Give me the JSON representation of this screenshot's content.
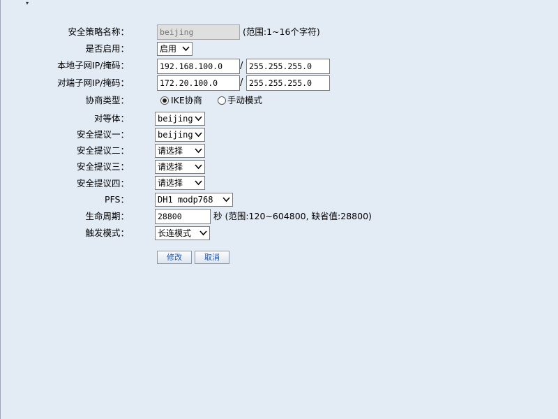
{
  "form": {
    "policy_name": {
      "label": "安全策略名称：",
      "value": "beijing",
      "hint": "(范围:1~16个字符)"
    },
    "enable": {
      "label": "是否启用：",
      "selected": "启用"
    },
    "local_subnet": {
      "label": "本地子网IP/掩码：",
      "ip": "192.168.100.0",
      "separator": "/",
      "mask": "255.255.255.0"
    },
    "remote_subnet": {
      "label": "对端子网IP/掩码：",
      "ip": "172.20.100.0",
      "separator": "/",
      "mask": "255.255.255.0"
    },
    "negotiation": {
      "label": "协商类型：",
      "option_ike": "IKE协商",
      "option_manual": "手动模式",
      "selected": "IKE协商"
    },
    "peer": {
      "label": "对等体：",
      "selected": "beijing"
    },
    "proposal1": {
      "label": "安全提议一：",
      "selected": "beijing"
    },
    "proposal2": {
      "label": "安全提议二：",
      "selected": "请选择"
    },
    "proposal3": {
      "label": "安全提议三：",
      "selected": "请选择"
    },
    "proposal4": {
      "label": "安全提议四：",
      "selected": "请选择"
    },
    "pfs": {
      "label": "PFS：",
      "selected": "DH1 modp768"
    },
    "lifetime": {
      "label": "生命周期：",
      "value": "28800",
      "hint": "秒 (范围:120~604800, 缺省值:28800)"
    },
    "trigger": {
      "label": "触发模式：",
      "selected": "长连模式"
    }
  },
  "buttons": {
    "modify": "修改",
    "cancel": "取消"
  },
  "icons": {
    "dropdown": "chevron-down-icon",
    "radio": "radio-button-icon"
  }
}
